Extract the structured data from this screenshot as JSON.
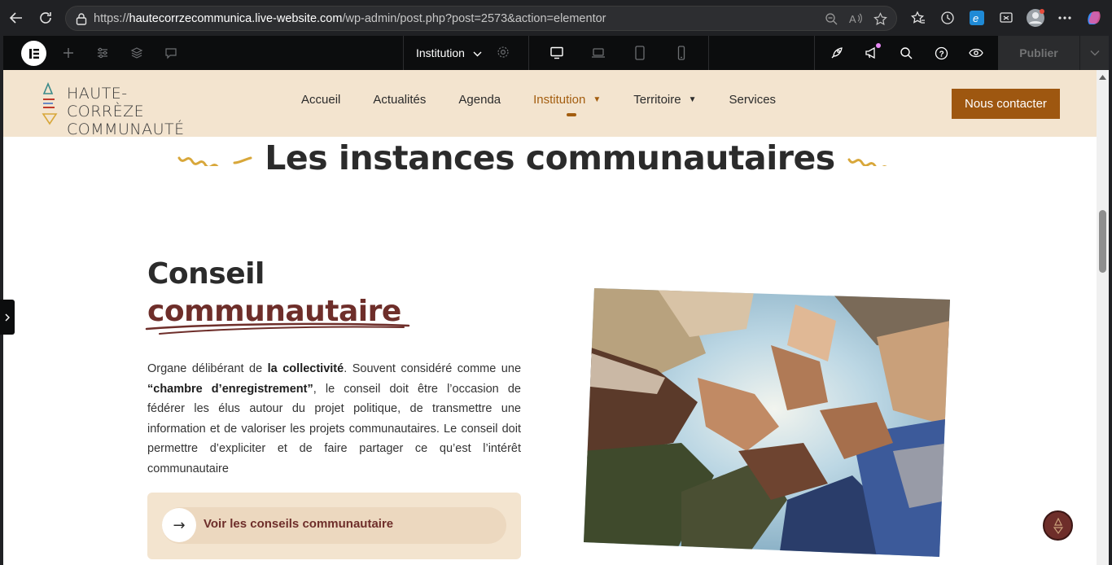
{
  "browser": {
    "url_protocol": "https://",
    "url_host": "hautecorrzecommunica.live-website.com",
    "url_path": "/wp-admin/post.php?post=2573&action=elementor",
    "toolbar_icons": [
      "favorites-icon",
      "history-icon",
      "edge-icon",
      "screenshot-icon",
      "profile-icon",
      "more-icon",
      "copilot-icon"
    ]
  },
  "elementor": {
    "document_name": "Institution",
    "publish_label": "Publier",
    "left_tools": [
      "add-element-icon",
      "site-settings-icon",
      "structure-icon",
      "notes-icon"
    ],
    "devices": [
      "desktop-icon",
      "laptop-icon",
      "tablet-icon",
      "mobile-icon"
    ],
    "right_tools": [
      "launch-icon",
      "whats-new-icon",
      "finder-icon",
      "help-icon",
      "preview-icon"
    ]
  },
  "site": {
    "logo_line1": "HAUTE-CORRÈZE",
    "logo_line2": "COMMUNAUTÉ",
    "nav": [
      {
        "label": "Accueil",
        "has_submenu": false,
        "active": false
      },
      {
        "label": "Actualités",
        "has_submenu": false,
        "active": false
      },
      {
        "label": "Agenda",
        "has_submenu": false,
        "active": false
      },
      {
        "label": "Institution",
        "has_submenu": true,
        "active": true
      },
      {
        "label": "Territoire",
        "has_submenu": true,
        "active": false
      },
      {
        "label": "Services",
        "has_submenu": false,
        "active": false
      }
    ],
    "cta_label": "Nous contacter"
  },
  "content": {
    "section_title": "Les instances communautaires",
    "heading_line1": "Conseil",
    "heading_line2": "communautaire",
    "para_part1": "Organe délibérant de ",
    "para_bold1": "la collectivité",
    "para_part2": ". Souvent considéré comme une ",
    "para_bold2": "“chambre d’enregistrement”",
    "para_part3": ", le conseil doit être l’occasion de fédérer les élus autour du projet politique, de transmettre une information et de valoriser les projets communautaires. Le conseil doit permettre d’expliciter et de faire partager ce qu’est l’intérêt communautaire",
    "link_label": "Voir les conseils communautaire",
    "arrow": "→"
  },
  "colors": {
    "brand_brown": "#9e5710",
    "accent_maroon": "#6e2e2a",
    "header_beige": "#f3e4cf",
    "squiggle_gold": "#d8a73a"
  }
}
